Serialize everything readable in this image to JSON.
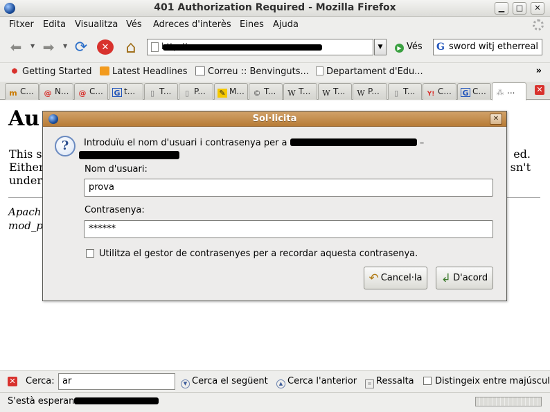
{
  "window": {
    "title": "401 Authorization Required - Mozilla Firefox",
    "minimize": "▁",
    "maximize": "□",
    "close": "✕"
  },
  "menu": [
    "Fitxer",
    "Edita",
    "Visualitza",
    "Vés",
    "Adreces d'interès",
    "Eines",
    "Ajuda"
  ],
  "toolbar": {
    "back": "⬅",
    "forward": "➡",
    "reload": "⟳",
    "stop": "✕",
    "home": "⌂",
    "url": "http://",
    "go_label": "Vés",
    "search_text": "sword witj etherreal"
  },
  "bookmarks": [
    "Getting Started",
    "Latest Headlines",
    "Correu :: Benvinguts...",
    "Departament d'Edu..."
  ],
  "bookmarks_more": "»",
  "tabs": [
    {
      "label": "C...",
      "icon": "m"
    },
    {
      "label": "N...",
      "icon": "@"
    },
    {
      "label": "C...",
      "icon": "@"
    },
    {
      "label": "t...",
      "icon": "G"
    },
    {
      "label": "T...",
      "icon": "▯"
    },
    {
      "label": "P...",
      "icon": "▯"
    },
    {
      "label": "M...",
      "icon": "✎"
    },
    {
      "label": "T...",
      "icon": "©"
    },
    {
      "label": "T...",
      "icon": "W"
    },
    {
      "label": "T...",
      "icon": "W"
    },
    {
      "label": "P...",
      "icon": "W"
    },
    {
      "label": "T...",
      "icon": "▯"
    },
    {
      "label": "C...",
      "icon": "Y!"
    },
    {
      "label": "C...",
      "icon": "G"
    },
    {
      "label": "...",
      "icon": "⁂"
    }
  ],
  "page": {
    "heading": "Au",
    "line1_start": "This s",
    "line1_end": "ed.",
    "line2_start": "Either",
    "line2_end": "sn't",
    "line3_start": "under",
    "address_1": "Apach",
    "address_2": "mod_p"
  },
  "dialog": {
    "title": "Sol·licita",
    "close": "✕",
    "prompt": "Introduïu el nom d'usuari i contrasenya per a",
    "prompt_suffix": "–",
    "username_label": "Nom d'usuari:",
    "username_value": "prova",
    "password_label": "Contrasenya:",
    "password_value": "******",
    "remember_label": "Utilitza el gestor de contrasenyes per a recordar aquesta contrasenya.",
    "remember_checked": false,
    "cancel_label": "Cancel·la",
    "ok_label": "D'acord"
  },
  "findbar": {
    "close": "✕",
    "label": "Cerca:",
    "value": "ar",
    "next_label": "Cerca el següent",
    "prev_label": "Cerca l'anterior",
    "highlight_label": "Ressalta",
    "match_case_label": "Distingeix entre majúscul"
  },
  "status": {
    "text": "S'està esperan"
  }
}
